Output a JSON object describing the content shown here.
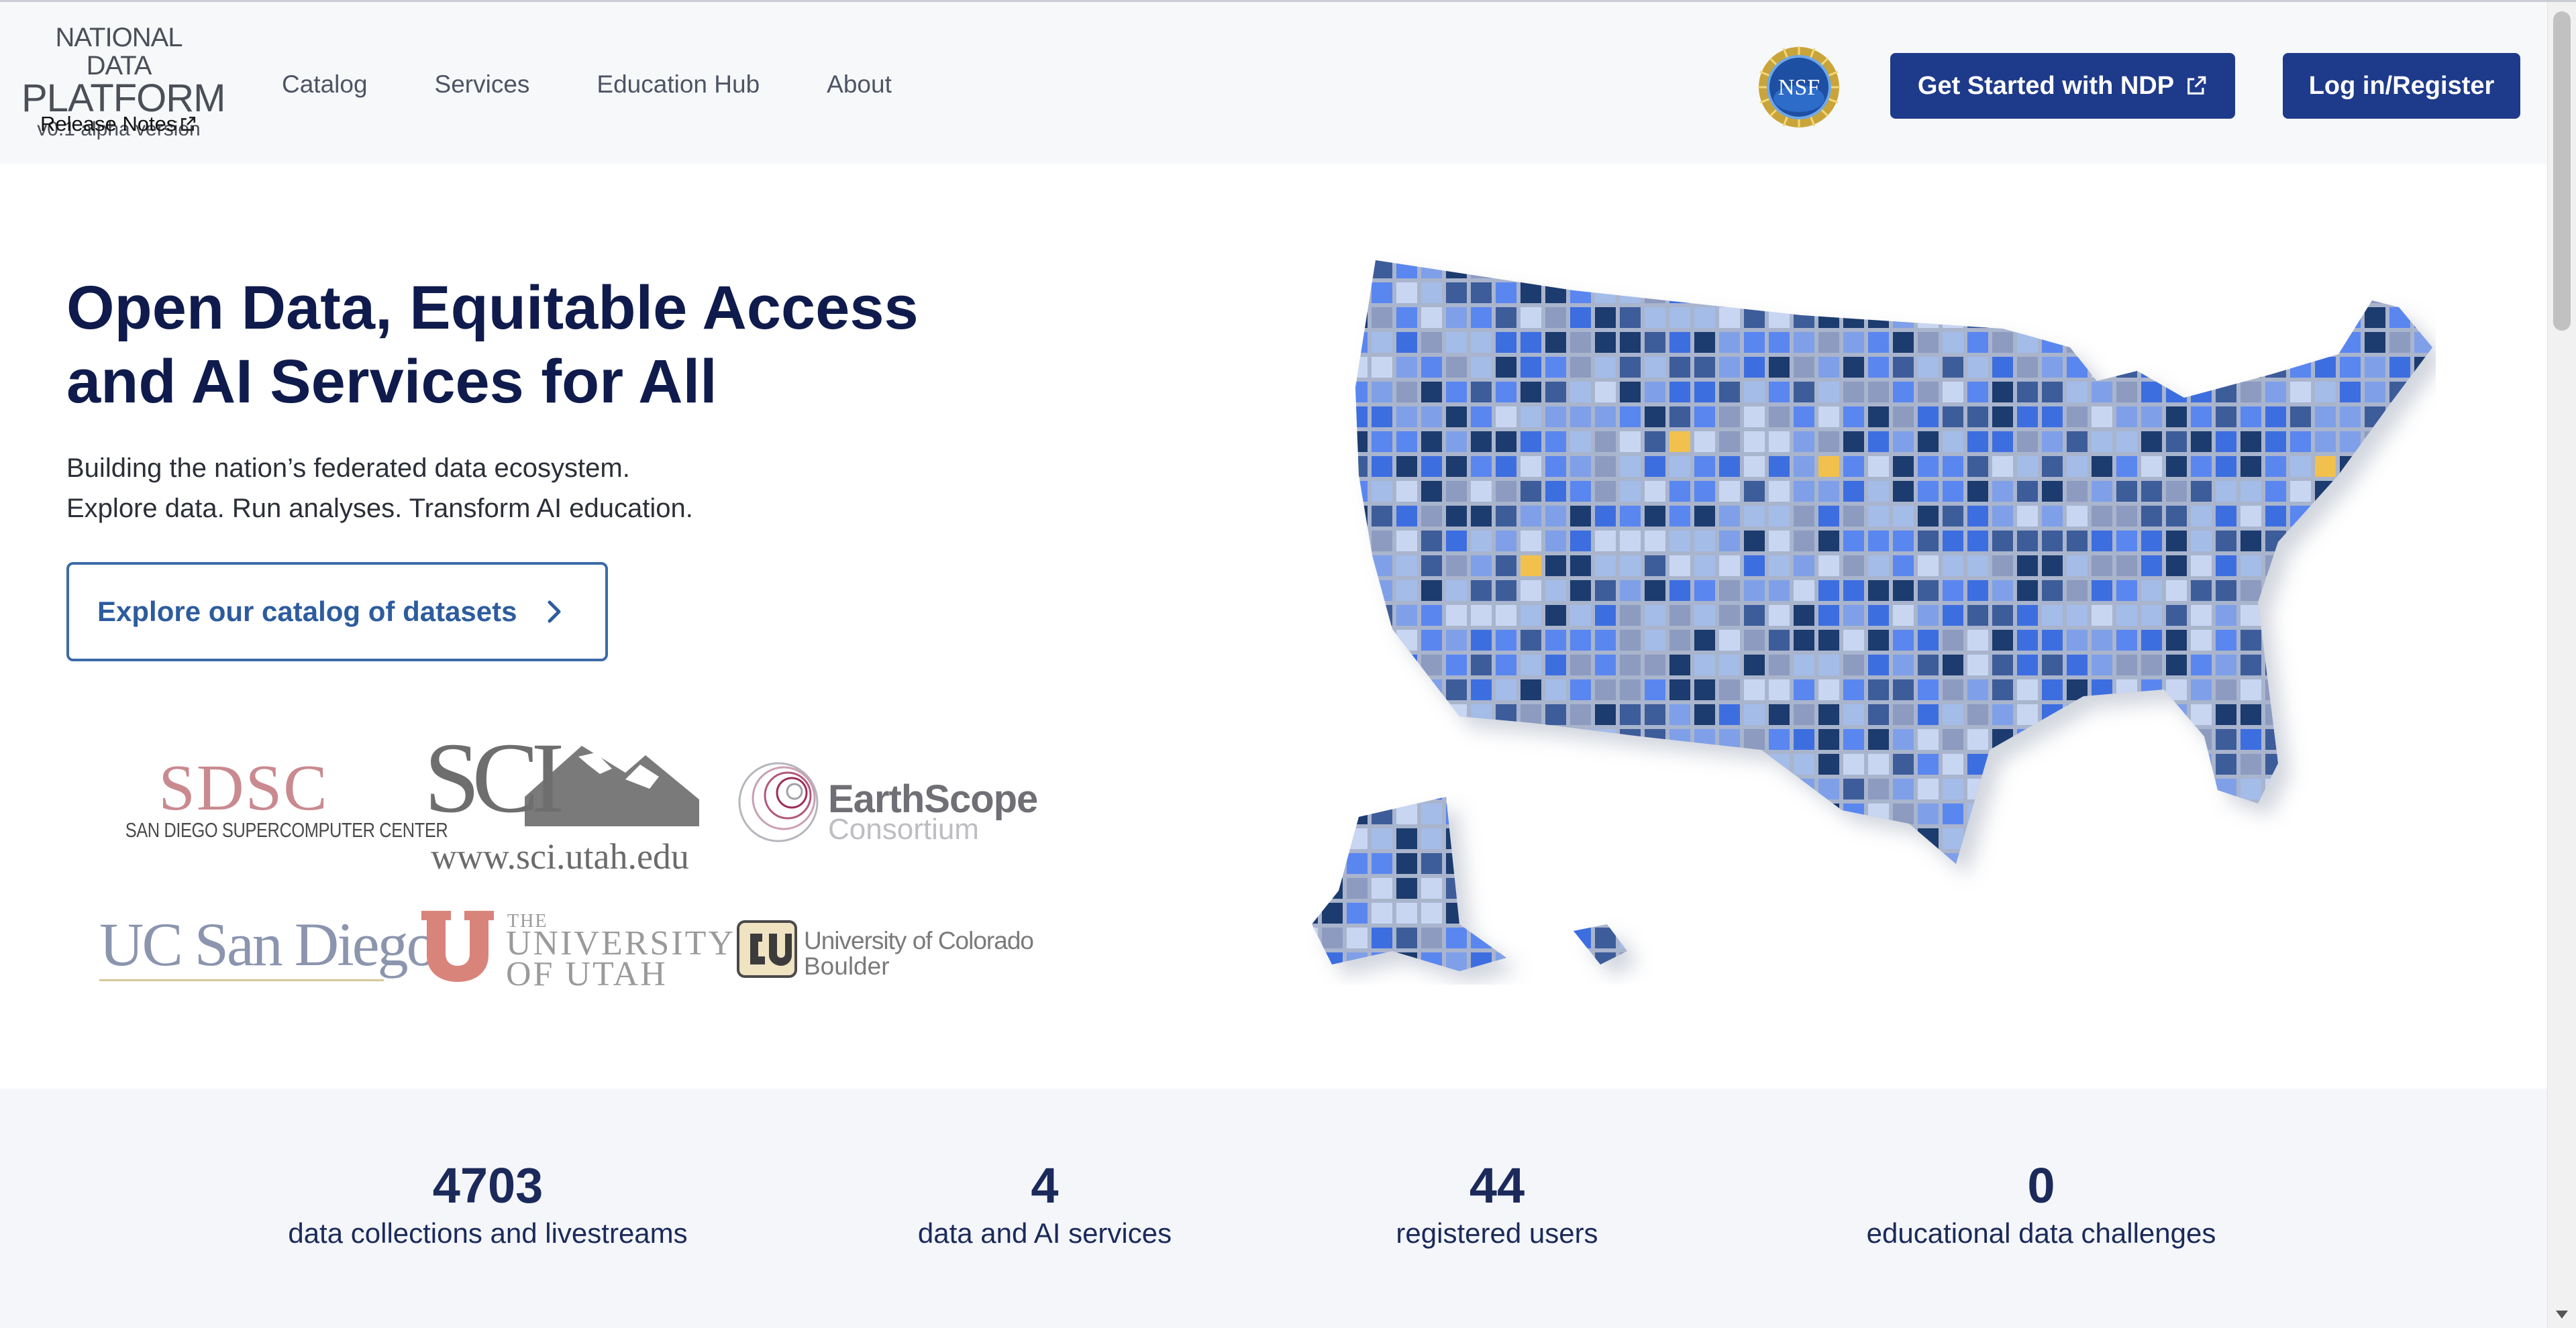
{
  "brand": {
    "line1": "NATIONAL DATA",
    "line2": "PLATFORM",
    "version": "v0.1 alpha version",
    "release_notes": "Release Notes"
  },
  "nav": {
    "catalog": "Catalog",
    "services": "Services",
    "education": "Education Hub",
    "about": "About"
  },
  "header": {
    "nsf_badge": "NSF",
    "get_started": "Get Started with NDP",
    "login": "Log in/Register"
  },
  "hero": {
    "title_line1": "Open Data, Equitable Access",
    "title_line2": "and AI Services for All",
    "subtitle_line1": "Building the nation’s federated data ecosystem.",
    "subtitle_line2": "Explore data. Run analyses. Transform AI education.",
    "cta": "Explore our catalog of datasets"
  },
  "partners": {
    "sdsc_abbr": "SDSC",
    "sdsc_full": "SAN DIEGO SUPERCOMPUTER CENTER",
    "sci_url": "www.sci.utah.edu",
    "earthscope_name": "EarthScope",
    "earthscope_sub": "Consortium",
    "ucsd": "UC San Diego",
    "utah_the": "THE",
    "utah_line2": "UNIVERSITY",
    "utah_line3": "OF UTAH",
    "cu_line1": "University of Colorado",
    "cu_line2": "Boulder"
  },
  "stats": [
    {
      "value": "4703",
      "label": "data collections and livestreams"
    },
    {
      "value": "4",
      "label": "data and AI services"
    },
    {
      "value": "44",
      "label": "registered users"
    },
    {
      "value": "0",
      "label": "educational data challenges"
    }
  ],
  "colors": {
    "primary": "#1e3a8a",
    "heading": "#0f1b4c",
    "cta_border": "#3d6aa9",
    "map_palette": [
      "#1f3a6e",
      "#3e5c9a",
      "#3e6ee0",
      "#5a86f0",
      "#7fa0e8",
      "#a4bce8",
      "#c8d6f2",
      "#8d9bc0",
      "#f2c14e"
    ]
  },
  "icons": {
    "external_link": "external-link-icon",
    "chevron": "chevron-right-icon",
    "nsf": "nsf-seal-icon"
  }
}
